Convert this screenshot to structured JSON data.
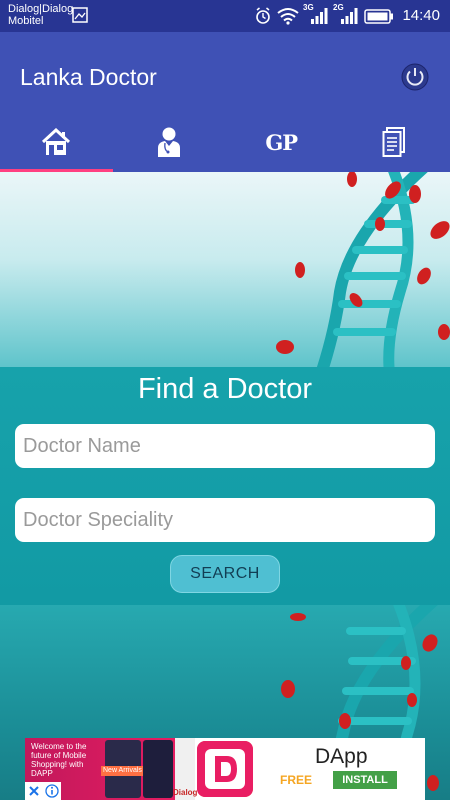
{
  "status_bar": {
    "carrier_line1": "Dialog|Dialog",
    "carrier_line2": "Mobitel",
    "network_1": "3G",
    "network_2": "2G",
    "time": "14:40",
    "icons": [
      "image-icon",
      "alarm-icon",
      "wifi-icon",
      "signal-icon",
      "signal-icon",
      "battery-icon"
    ]
  },
  "app_bar": {
    "title": "Lanka Doctor",
    "power_icon": "power-icon",
    "tabs": [
      {
        "icon": "home-icon",
        "active": true
      },
      {
        "icon": "doctor-icon",
        "active": false
      },
      {
        "label": "GP",
        "active": false
      },
      {
        "icon": "document-icon",
        "active": false
      }
    ],
    "colors": {
      "status_bar": "#283593",
      "primary": "#3f51b5",
      "tab_indicator": "#ff4081"
    }
  },
  "find": {
    "title": "Find a Doctor",
    "doctor_name_placeholder": "Doctor Name",
    "doctor_speciality_placeholder": "Doctor Speciality",
    "search_label": "SEARCH"
  },
  "ad": {
    "promo_text": "Welcome to the future of Mobile Shopping! with DAPP",
    "promo_badge": "New Arrivals",
    "brand": "Dialog",
    "app_name": "DApp",
    "price": "FREE",
    "install_label": "INSTALL"
  }
}
